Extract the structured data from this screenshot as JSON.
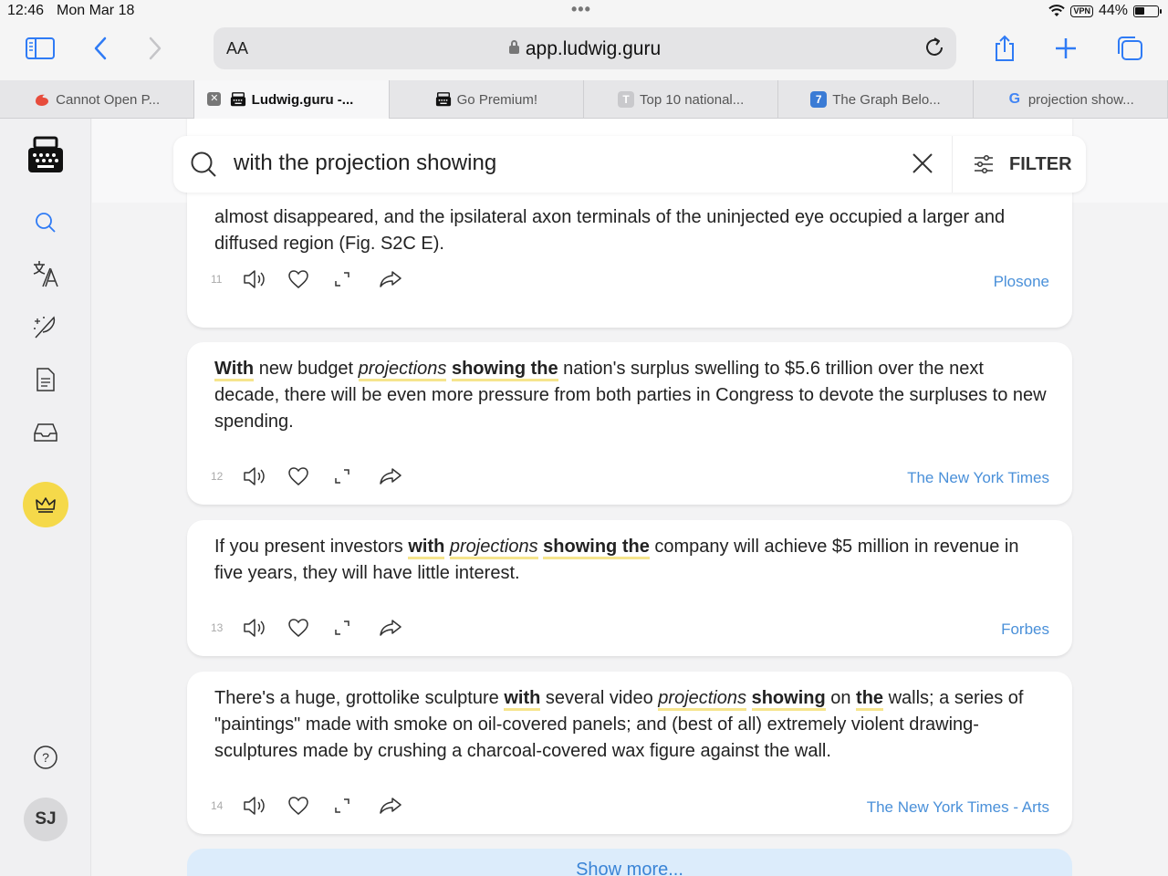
{
  "status": {
    "time": "12:46",
    "date": "Mon Mar 18",
    "dots": "•••",
    "vpn": "VPN",
    "battery": "44%"
  },
  "browser": {
    "aa": "AA",
    "url": "app.ludwig.guru"
  },
  "tabs": [
    {
      "label": "Cannot Open P...",
      "active": false
    },
    {
      "label": "Ludwig.guru -...",
      "active": true
    },
    {
      "label": "Go Premium!",
      "active": false
    },
    {
      "label": "Top 10 national...",
      "active": false,
      "fav": "T"
    },
    {
      "label": "The Graph Belo...",
      "active": false,
      "fav": "7"
    },
    {
      "label": "projection show...",
      "active": false,
      "fav": "G"
    }
  ],
  "sidebar": {
    "avatar": "SJ"
  },
  "search": {
    "query": "with the projection showing",
    "filter_label": "FILTER"
  },
  "cards": [
    {
      "number": "11",
      "source": "Plosone",
      "text_parts": [
        {
          "t": "almost disappeared, and the ipsilateral axon terminals of the uninjected eye occupied a larger and diffused region (Fig. S2C E).",
          "s": ""
        }
      ]
    },
    {
      "number": "12",
      "source": "The New York Times",
      "text_parts": [
        {
          "t": "With",
          "s": "b"
        },
        {
          "t": " new budget ",
          "s": ""
        },
        {
          "t": "projections",
          "s": "i"
        },
        {
          "t": " ",
          "s": ""
        },
        {
          "t": "showing the",
          "s": "b"
        },
        {
          "t": " nation's surplus swelling to $5.6 trillion over the next decade, there will be even more pressure from both parties in Congress to devote the surpluses to new spending.",
          "s": ""
        }
      ]
    },
    {
      "number": "13",
      "source": "Forbes",
      "text_parts": [
        {
          "t": "If you present investors ",
          "s": ""
        },
        {
          "t": "with",
          "s": "b"
        },
        {
          "t": " ",
          "s": ""
        },
        {
          "t": "projections",
          "s": "i"
        },
        {
          "t": " ",
          "s": ""
        },
        {
          "t": "showing the",
          "s": "b"
        },
        {
          "t": " company will achieve $5 million in revenue in five years, they will have little interest.",
          "s": ""
        }
      ]
    },
    {
      "number": "14",
      "source": "The New York Times - Arts",
      "text_parts": [
        {
          "t": "There's a huge, grottolike sculpture ",
          "s": ""
        },
        {
          "t": "with",
          "s": "b"
        },
        {
          "t": " several video ",
          "s": ""
        },
        {
          "t": "projections",
          "s": "i"
        },
        {
          "t": " ",
          "s": ""
        },
        {
          "t": "showing",
          "s": "b"
        },
        {
          "t": " on ",
          "s": ""
        },
        {
          "t": "the",
          "s": "b"
        },
        {
          "t": " walls; a series of \"paintings\" made with smoke on oil-covered panels; and (best of all) extremely violent drawing-sculptures made by crushing a charcoal-covered wax figure against the wall.",
          "s": ""
        }
      ]
    }
  ],
  "show_more": "Show more...",
  "colors": {
    "accent": "#4a90d9",
    "highlight": "#f6e58d",
    "premium": "#f5d94a"
  }
}
